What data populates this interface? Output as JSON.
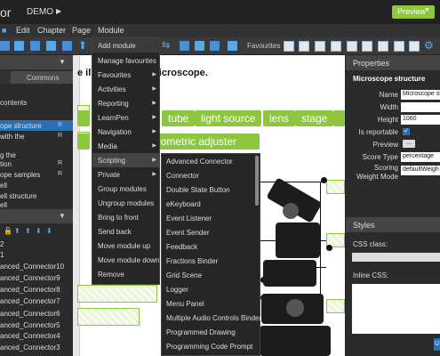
{
  "app": {
    "logo": "or",
    "project": "DEMO",
    "preview_label": "Preview"
  },
  "menubar": [
    "Edit",
    "Chapter",
    "Page",
    "Module"
  ],
  "toolbar": {
    "favourites_label": "Favourites"
  },
  "left_panel": {
    "tab_label": "Commons",
    "tree": [
      {
        "label": "contents",
        "r": ""
      },
      {
        "label": "ope structure",
        "r": "R",
        "selected": true
      },
      {
        "label": "with the",
        "r": "R"
      },
      {
        "label": "g the",
        "r": ""
      },
      {
        "label": "tion",
        "r": "R"
      },
      {
        "label": "ope samples",
        "r": "R"
      },
      {
        "label": "ell",
        "r": ""
      },
      {
        "label": "ell structure",
        "r": ""
      },
      {
        "label": "ell",
        "r": ""
      }
    ],
    "list": [
      "2",
      "1",
      "anced_Connector10",
      "anced_Connector9",
      "anced_Connector8",
      "anced_Connector7",
      "anced_Connector6",
      "anced_Connector5",
      "anced_Connector4",
      "anced_Connector3"
    ]
  },
  "canvas": {
    "title_pre": "e ill",
    "title": "microscope.",
    "chips": [
      "tube",
      "light source",
      "lens",
      "stage",
      "macrometric adjuster"
    ]
  },
  "module_menu": [
    {
      "label": "Add module",
      "arrow": false
    },
    {
      "label": "Manage favourites",
      "arrow": false
    },
    {
      "label": "Favourites",
      "arrow": true
    },
    {
      "label": "Activities",
      "arrow": true
    },
    {
      "label": "Reporting",
      "arrow": true
    },
    {
      "label": "LearnPen",
      "arrow": true
    },
    {
      "label": "Navigation",
      "arrow": true
    },
    {
      "label": "Media",
      "arrow": true
    },
    {
      "label": "Scripting",
      "arrow": true,
      "highlighted": true
    },
    {
      "label": "Private",
      "arrow": true
    },
    {
      "label": "Group modules",
      "arrow": false
    },
    {
      "label": "Ungroup modules",
      "arrow": false
    },
    {
      "label": "Bring to front",
      "arrow": false
    },
    {
      "label": "Send back",
      "arrow": false
    },
    {
      "label": "Move module up",
      "arrow": false
    },
    {
      "label": "Move module down",
      "arrow": false
    },
    {
      "label": "Remove",
      "arrow": false
    }
  ],
  "scripting_menu": [
    "Advanced Connector",
    "Connector",
    "Double State Button",
    "eKeyboard",
    "Event Listener",
    "Event Sender",
    "Feedback",
    "Fractions Binder",
    "Grid Scene",
    "Logger",
    "Menu Panel",
    "Multiple Audio Controls Binder",
    "Programmed Drawing",
    "Programming Code Prompt"
  ],
  "properties": {
    "header": "Properties",
    "subtitle": "Microscope structure",
    "name_label": "Name",
    "name_value": "Microscope st",
    "width_label": "Width",
    "width_value": "",
    "height_label": "Height",
    "height_value": "1060",
    "reportable_label": "Is reportable",
    "preview_label": "Preview",
    "preview_btn": "...",
    "score_type_label": "Score Type",
    "score_type_value": "percentage",
    "scoring_label": "Scoring Weight Mode",
    "scoring_value": "defaultWeigh"
  },
  "styles": {
    "header": "Styles",
    "css_class_label": "CSS class:",
    "inline_css_label": "Inline CSS:",
    "button": "U"
  }
}
